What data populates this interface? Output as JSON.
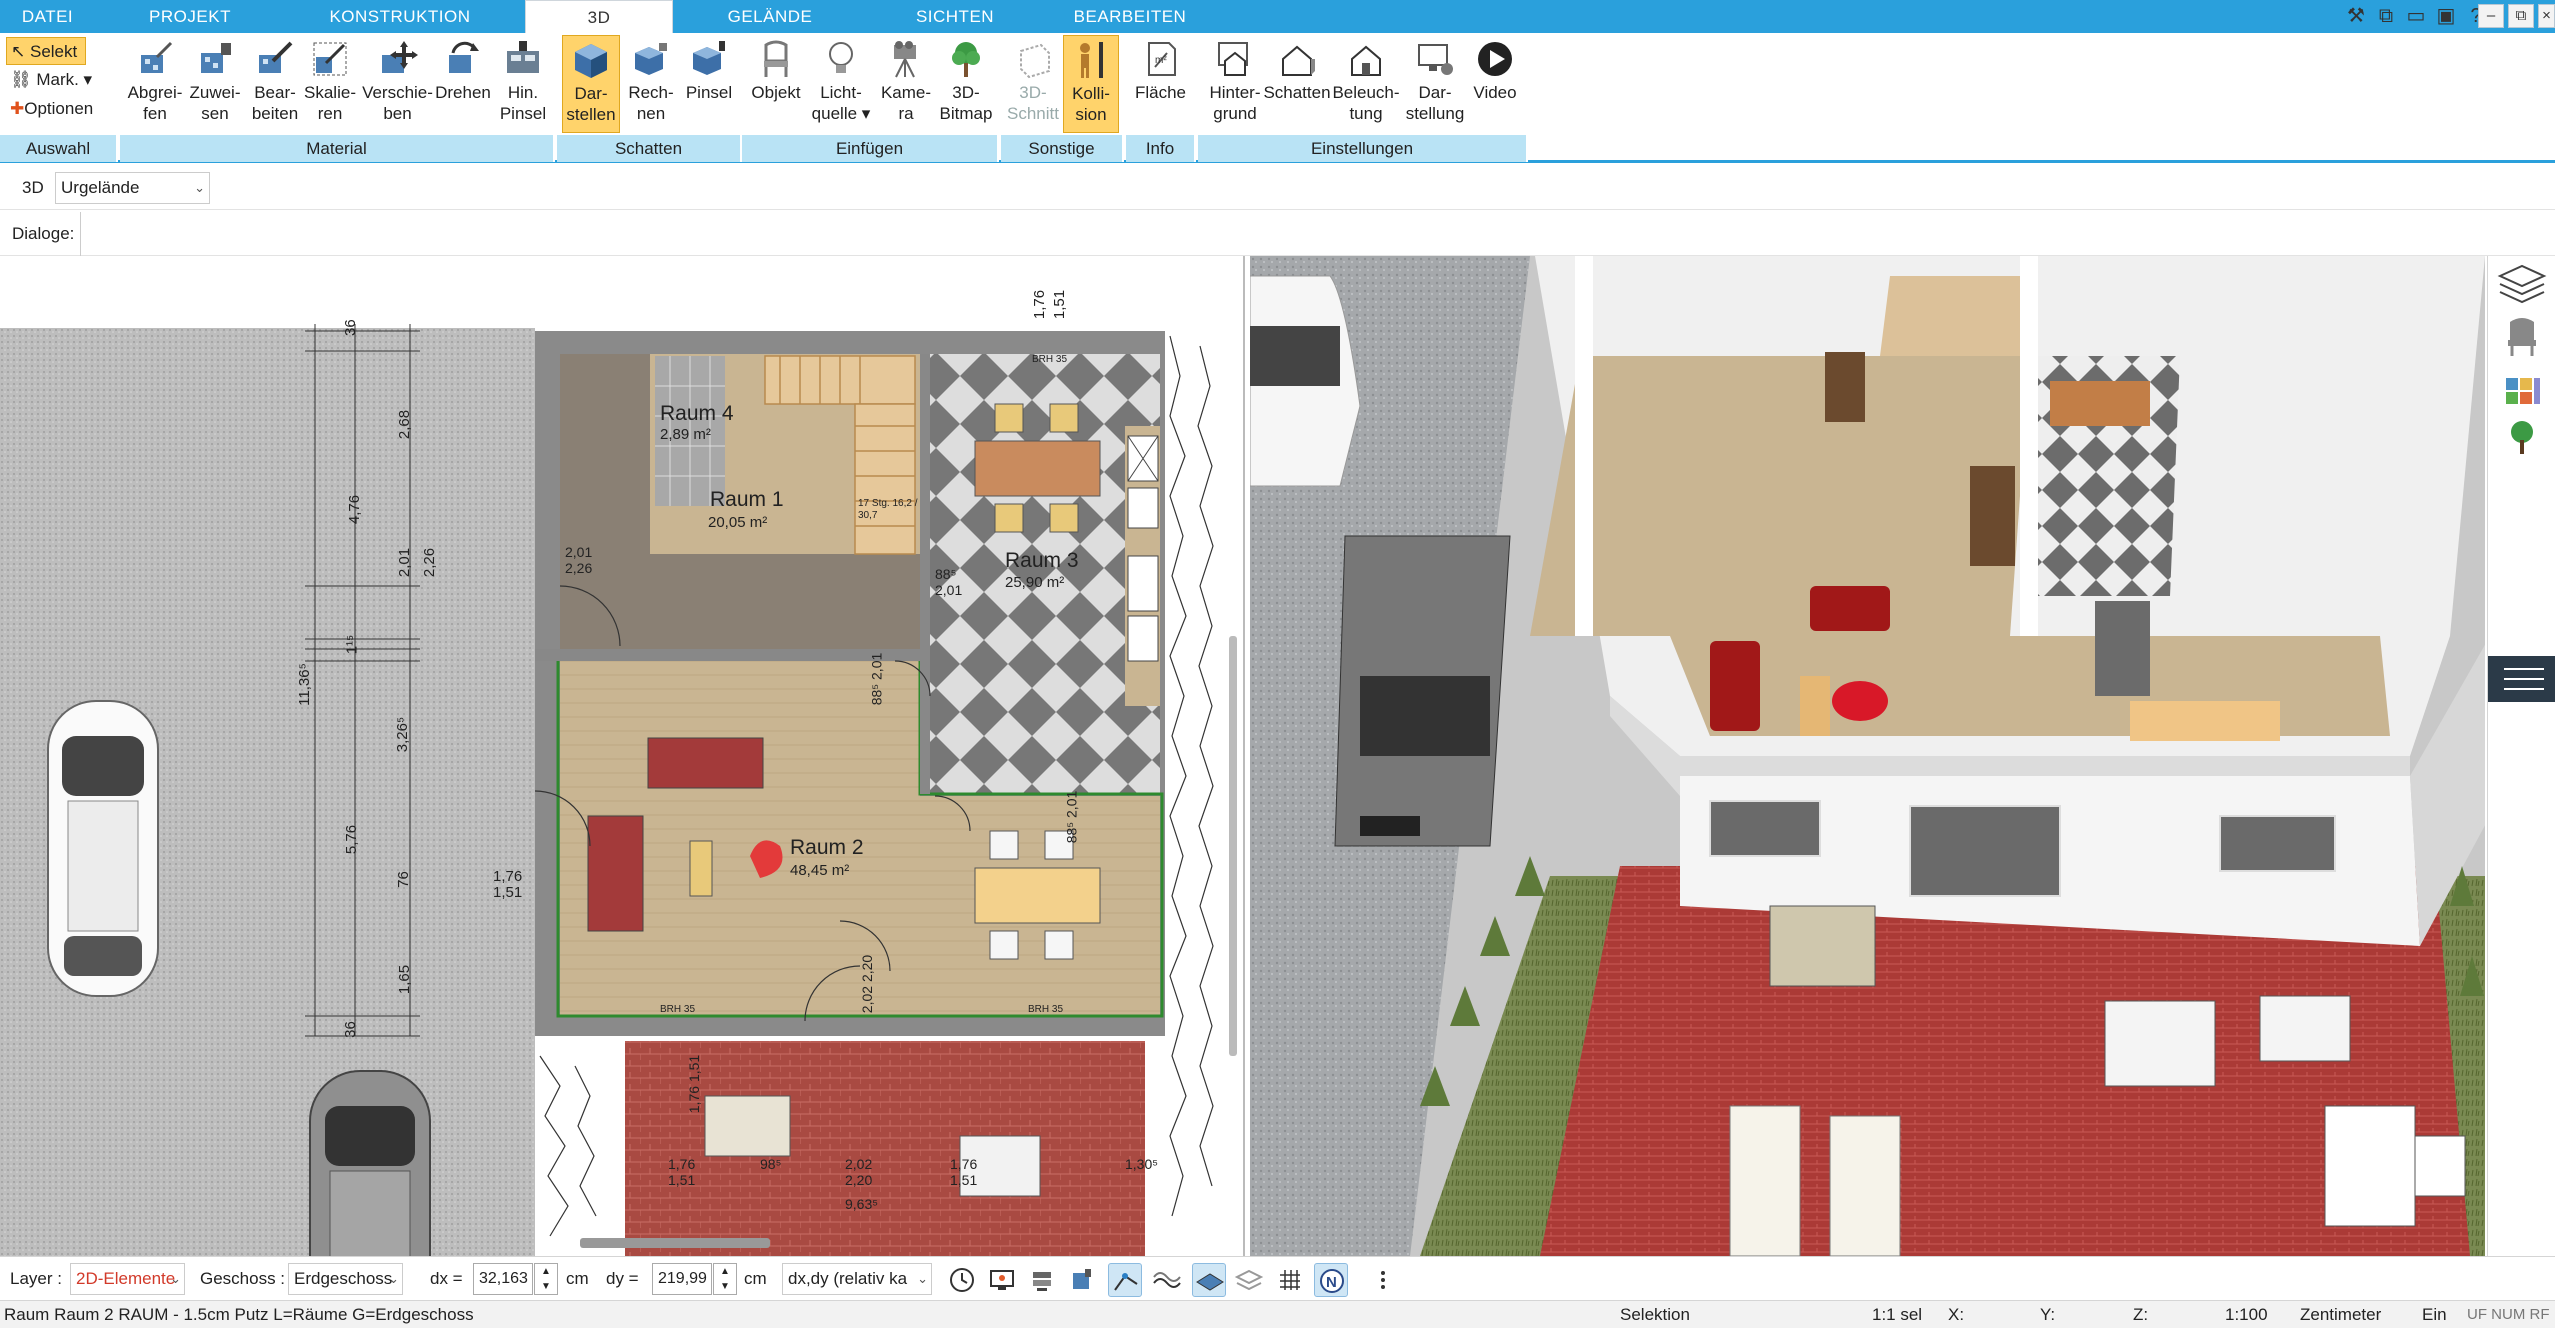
{
  "menu": {
    "tabs": [
      "DATEI",
      "PROJEKT",
      "KONSTRUKTION",
      "3D",
      "GELÄNDE",
      "SICHTEN",
      "BEARBEITEN"
    ],
    "active": "3D"
  },
  "ribbon": {
    "auswahl": {
      "selekt": "Selekt",
      "mark": "Mark.",
      "optionen": "Optionen",
      "label": "Auswahl"
    },
    "material": {
      "label": "Material",
      "buttons": [
        {
          "l1": "Abgrei-",
          "l2": "fen"
        },
        {
          "l1": "Zuwei-",
          "l2": "sen"
        },
        {
          "l1": "Bear-",
          "l2": "beiten"
        },
        {
          "l1": "Skalie-",
          "l2": "ren"
        },
        {
          "l1": "Verschie-",
          "l2": "ben"
        },
        {
          "l1": "Drehen",
          "l2": ""
        },
        {
          "l1": "Hin.",
          "l2": "Pinsel"
        }
      ]
    },
    "schatten": {
      "label": "Schatten",
      "buttons": [
        {
          "l1": "Dar-",
          "l2": "stellen"
        },
        {
          "l1": "Rech-",
          "l2": "nen"
        },
        {
          "l1": "Pinsel",
          "l2": ""
        }
      ]
    },
    "einfuegen": {
      "label": "Einfügen",
      "buttons": [
        {
          "l1": "Objekt",
          "l2": ""
        },
        {
          "l1": "Licht-",
          "l2": "quelle"
        },
        {
          "l1": "Kame-",
          "l2": "ra"
        },
        {
          "l1": "3D-",
          "l2": "Bitmap"
        }
      ]
    },
    "sonstige": {
      "label": "Sonstige",
      "buttons": [
        {
          "l1": "3D-",
          "l2": "Schnitt"
        },
        {
          "l1": "Kolli-",
          "l2": "sion"
        }
      ]
    },
    "info": {
      "label": "Info",
      "buttons": [
        {
          "l1": "Fläche",
          "l2": ""
        }
      ]
    },
    "einstellungen": {
      "label": "Einstellungen",
      "buttons": [
        {
          "l1": "Hinter-",
          "l2": "grund"
        },
        {
          "l1": "Schatten",
          "l2": ""
        },
        {
          "l1": "Beleuch-",
          "l2": "tung"
        },
        {
          "l1": "Dar-",
          "l2": "stellung"
        },
        {
          "l1": "Video",
          "l2": ""
        }
      ]
    }
  },
  "row2": {
    "mode": "3D",
    "terrain": "Urgelände"
  },
  "row3": {
    "dialoge": "Dialoge:"
  },
  "plan": {
    "rooms": [
      {
        "name": "Raum 4",
        "area": "2,89 m²"
      },
      {
        "name": "Raum 1",
        "area": "20,05 m²"
      },
      {
        "name": "Raum 3",
        "area": "25,90 m²"
      },
      {
        "name": "Raum 2",
        "area": "48,45 m²"
      }
    ],
    "stairs": "17 Stg. 16,2 / 30,7",
    "brh": "BRH 35",
    "dims_v": [
      "2,68",
      "4,76",
      "2,01",
      "2,26",
      "11,36⁵",
      "3,26⁵",
      "1¹⁵",
      "5,76",
      "76",
      "1,65",
      "36",
      "36"
    ],
    "dims_top": [
      "1,76",
      "1,51"
    ],
    "dims_side": [
      "1,76",
      "1,51"
    ],
    "door_dims": [
      "2,01",
      "2,26",
      "88⁵",
      "2,01",
      "88⁵",
      "2,01",
      "88⁵",
      "2,01",
      "2,02",
      "2,20"
    ],
    "bottom_dims": [
      "1,76",
      "1,51",
      "98⁵",
      "2,02",
      "2,20",
      "1,76",
      "1,51",
      "1,30⁵",
      "9,63⁵",
      "1,76",
      "1,51"
    ]
  },
  "bottom": {
    "layer_label": "Layer :",
    "layer_value": "2D-Elemente",
    "geschoss_label": "Geschoss :",
    "geschoss_value": "Erdgeschoss",
    "dx_label": "dx =",
    "dx_value": "32,163",
    "dx_unit": "cm",
    "dy_label": "dy =",
    "dy_value": "219,99",
    "dy_unit": "cm",
    "mode_value": "dx,dy (relativ ka"
  },
  "status": {
    "info": "Raum Raum 2 RAUM - 1.5cm Putz L=Räume G=Erdgeschoss",
    "selektion": "Selektion",
    "sel": "1:1 sel",
    "x": "X:",
    "y": "Y:",
    "z": "Z:",
    "scale": "1:100",
    "unit": "Zentimeter",
    "ein": "Ein",
    "flags": "UF  NUM  RF"
  },
  "colors": {
    "accent": "#2aa0dc",
    "ribbon_group": "#b9e3f5",
    "selected": "#ffd36b",
    "paving": "#a94a42",
    "floor": "#c9b592"
  }
}
